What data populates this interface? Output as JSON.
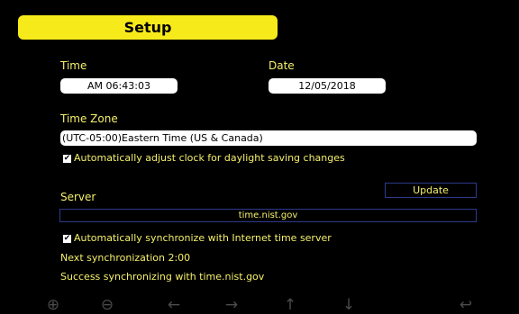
{
  "title": "Setup",
  "time": {
    "label": "Time",
    "value": "AM 06:43:03"
  },
  "date": {
    "label": "Date",
    "value": "12/05/2018"
  },
  "timezone": {
    "label": "Time Zone",
    "value": "(UTC-05:00)Eastern Time (US & Canada)"
  },
  "dst": {
    "label": "Automatically adjust clock for daylight saving changes",
    "checked": true
  },
  "server": {
    "label": "Server",
    "value": "time.nist.gov",
    "update_label": "Update"
  },
  "sync": {
    "label": "Automatically synchronize with Internet time server",
    "checked": true
  },
  "next_sync": "Next synchronization 2:00",
  "status": "Success synchronizing with time.nist.gov",
  "toolbar": {
    "zoom_in": "⊕",
    "zoom_out": "⊖",
    "left": "←",
    "right": "→",
    "up": "↑",
    "down": "↓",
    "back": "↩"
  },
  "colors": {
    "title_bg": "#f7ea1a",
    "text": "#f5f06b",
    "background": "#000000",
    "border": "#2d3a8c"
  }
}
